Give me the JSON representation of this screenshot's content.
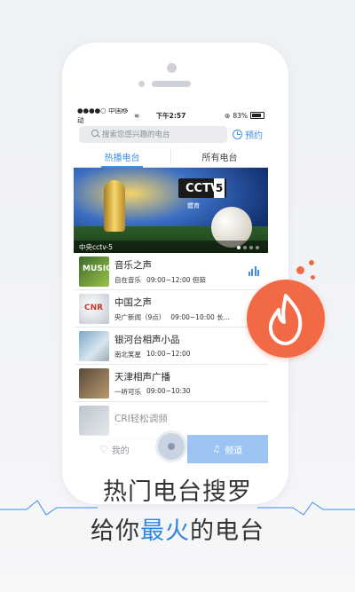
{
  "colors": {
    "accent": "#3d8ee6",
    "fire": "#f26a45",
    "highlight": "#2f86e0"
  },
  "status": {
    "carrier": "●●●●○ 中国移动",
    "time": "下午2:57",
    "battery": "83%"
  },
  "search": {
    "placeholder": "搜索您感兴趣的电台",
    "reserve_label": "预约",
    "alarm_icon": "alarm-clock-icon"
  },
  "tabs": [
    {
      "label": "热播电台"
    },
    {
      "label": "所有电台"
    }
  ],
  "banner": {
    "logo": "CCTV",
    "logo_num": "5",
    "subtitle": "體育",
    "caption": "中央cctv-5"
  },
  "stations": [
    {
      "name": "音乐之声",
      "sub1": "自在音乐",
      "sub2": "09:00~12:00  但茹"
    },
    {
      "name": "中国之声",
      "sub1": "央广新闻（9点）",
      "sub2": "09:00~10:00  长..."
    },
    {
      "name": "银河台相声小品",
      "sub1": "南北笑星",
      "sub2": "10:00~12:00"
    },
    {
      "name": "天津相声广播",
      "sub1": "一听可乐",
      "sub2": "09:00~10:30"
    },
    {
      "name": "CRI轻松调频",
      "sub1": "",
      "sub2": ""
    }
  ],
  "bottom": {
    "my_label": "我的",
    "channel_label": "频道"
  },
  "tagline": {
    "line1": "热门电台搜罗",
    "line2_pre": "给你",
    "line2_hl": "最火",
    "line2_post": "的电台"
  }
}
